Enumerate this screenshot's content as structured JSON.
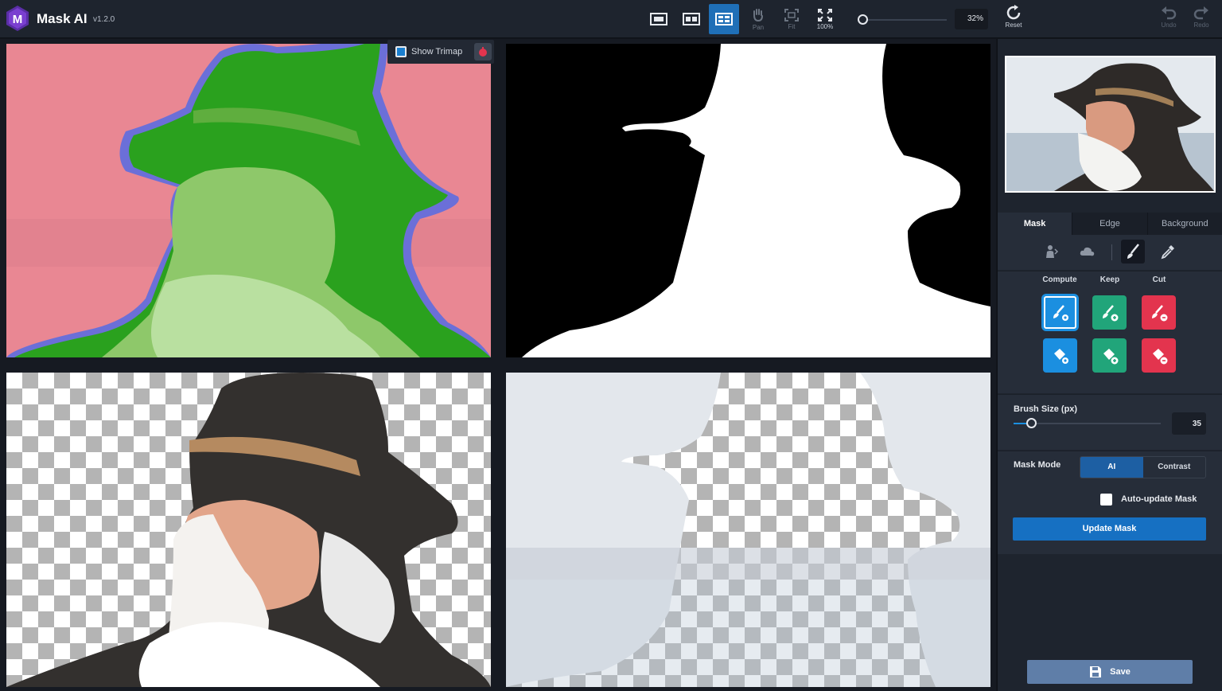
{
  "app": {
    "title": "Mask AI",
    "version": "v1.2.0"
  },
  "toolbar": {
    "pan_label": "Pan",
    "fit_label": "Fit",
    "actual_label": "100%",
    "zoom_value": "32%",
    "zoom_level": 0.05,
    "reset_label": "Reset",
    "undo_label": "Undo",
    "redo_label": "Redo"
  },
  "canvas": {
    "show_trimap_label": "Show Trimap"
  },
  "sidebar": {
    "tabs": [
      "Mask",
      "Edge",
      "Background"
    ],
    "brush_columns": [
      "Compute",
      "Keep",
      "Cut"
    ],
    "brush_size": {
      "label": "Brush Size (px)",
      "value": "35",
      "level": 0.08
    },
    "mask_mode": {
      "label": "Mask Mode",
      "options": [
        "AI",
        "Contrast"
      ],
      "selected": "AI"
    },
    "auto_update_label": "Auto-update Mask",
    "update_button": "Update Mask",
    "save_button": "Save"
  },
  "colors": {
    "accent": "#1b8fe0",
    "keep": "#21a57a",
    "cut": "#e3344e",
    "trimap_bg": "#e98793",
    "trimap_fg": "#2a9a1e"
  }
}
